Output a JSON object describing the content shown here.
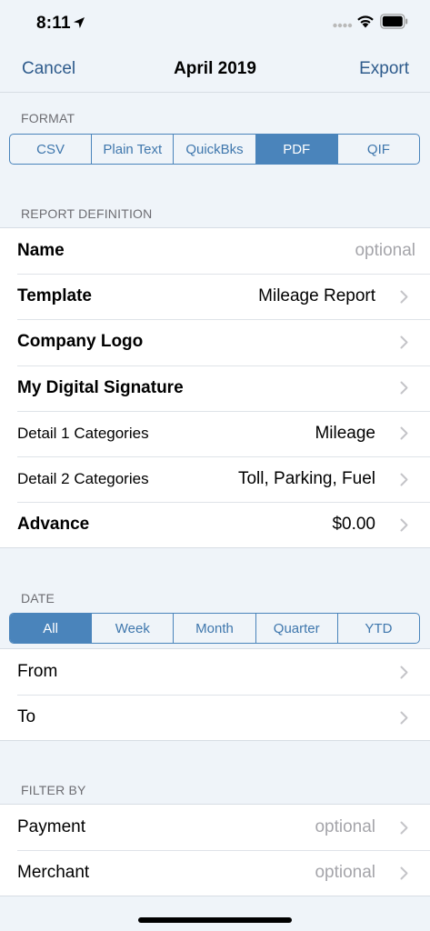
{
  "status": {
    "time": "8:11"
  },
  "nav": {
    "cancel": "Cancel",
    "title": "April 2019",
    "export": "Export"
  },
  "format": {
    "header": "FORMAT",
    "options": [
      "CSV",
      "Plain Text",
      "QuickBks",
      "PDF",
      "QIF"
    ],
    "selected": "PDF"
  },
  "report": {
    "header": "REPORT DEFINITION",
    "rows": [
      {
        "label": "Name",
        "value": "optional"
      },
      {
        "label": "Template",
        "value": "Mileage Report"
      },
      {
        "label": "Company Logo",
        "value": ""
      },
      {
        "label": "My Digital Signature",
        "value": ""
      },
      {
        "label": "Detail 1 Categories",
        "value": "Mileage"
      },
      {
        "label": "Detail 2 Categories",
        "value": "Toll, Parking, Fuel"
      },
      {
        "label": "Advance",
        "value": "$0.00"
      }
    ]
  },
  "date": {
    "header": "DATE",
    "options": [
      "All",
      "Week",
      "Month",
      "Quarter",
      "YTD"
    ],
    "selected": "All",
    "rows": [
      {
        "label": "From",
        "value": ""
      },
      {
        "label": "To",
        "value": ""
      }
    ]
  },
  "filter": {
    "header": "FILTER BY",
    "rows": [
      {
        "label": "Payment",
        "value": "optional"
      },
      {
        "label": "Merchant",
        "value": "optional"
      }
    ]
  },
  "colors": {
    "accent": "#4a84bb",
    "nav_text": "#2e5b8c",
    "background": "#eff4f9",
    "placeholder": "#a5a5aa"
  }
}
